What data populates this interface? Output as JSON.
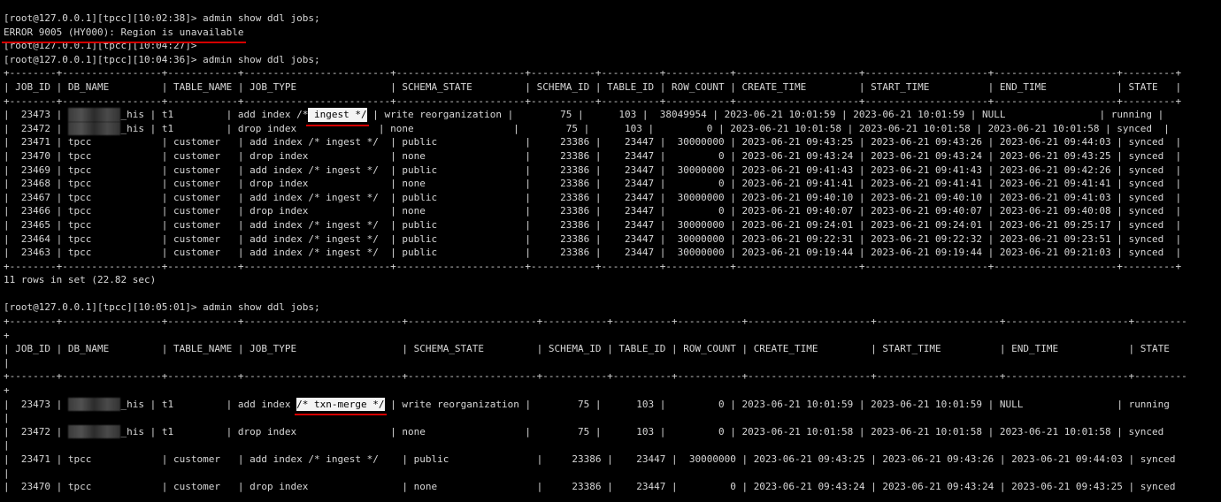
{
  "terminal": {
    "lines_top": [
      {
        "parts": [
          {
            "t": "[root@127.0.0.1][tpcc][10:02:38]> admin show ddl jobs;"
          }
        ]
      },
      {
        "parts": [
          {
            "t": "ERROR 9005 (HY000): Region is unavailable",
            "cls": "ul"
          }
        ]
      },
      {
        "parts": [
          {
            "t": "[root@127.0.0.1][tpcc][10:04:27]>"
          }
        ]
      },
      {
        "parts": [
          {
            "t": "[root@127.0.0.1][tpcc][10:04:36]> admin show ddl jobs;"
          }
        ]
      },
      {
        "parts": [
          {
            "t": "+--------+-----------------+------------+-------------------------+----------------------+-----------+----------+-----------+---------------------+---------------------+---------------------+---------+"
          }
        ]
      },
      {
        "parts": [
          {
            "t": "| JOB_ID | DB_NAME         | TABLE_NAME | JOB_TYPE                | SCHEMA_STATE         | SCHEMA_ID | TABLE_ID | ROW_COUNT | CREATE_TIME         | START_TIME          | END_TIME            | STATE   |"
          }
        ]
      },
      {
        "parts": [
          {
            "t": "+--------+-----------------+------------+-------------------------+----------------------+-----------+----------+-----------+---------------------+---------------------+---------------------+---------+"
          }
        ]
      },
      {
        "parts": [
          {
            "t": "|  23473 | "
          },
          {
            "t": "xxxxxxxxx",
            "cls": "blur"
          },
          {
            "t": "_his | t1         | add index /*"
          },
          {
            "t": " ingest */",
            "cls": "hl"
          },
          {
            "t": " | write reorganization |        75 |      103 |  38049954 | 2023-06-21 10:01:59 | 2023-06-21 10:01:59 | NULL                | running |"
          }
        ]
      },
      {
        "parts": [
          {
            "t": "|  23472 | "
          },
          {
            "t": "xxxxxxxxx",
            "cls": "blur"
          },
          {
            "t": "_his | t1         | drop index              | none                 |        75 |      103 |         0 | 2023-06-21 10:01:58 | 2023-06-21 10:01:58 | 2023-06-21 10:01:58 | synced  |"
          }
        ]
      },
      {
        "parts": [
          {
            "t": "|  23471 | tpcc            | customer   | add index /* ingest */  | public               |     23386 |    23447 |  30000000 | 2023-06-21 09:43:25 | 2023-06-21 09:43:26 | 2023-06-21 09:44:03 | synced  |"
          }
        ]
      },
      {
        "parts": [
          {
            "t": "|  23470 | tpcc            | customer   | drop index              | none                 |     23386 |    23447 |         0 | 2023-06-21 09:43:24 | 2023-06-21 09:43:24 | 2023-06-21 09:43:25 | synced  |"
          }
        ]
      },
      {
        "parts": [
          {
            "t": "|  23469 | tpcc            | customer   | add index /* ingest */  | public               |     23386 |    23447 |  30000000 | 2023-06-21 09:41:43 | 2023-06-21 09:41:43 | 2023-06-21 09:42:26 | synced  |"
          }
        ]
      },
      {
        "parts": [
          {
            "t": "|  23468 | tpcc            | customer   | drop index              | none                 |     23386 |    23447 |         0 | 2023-06-21 09:41:41 | 2023-06-21 09:41:41 | 2023-06-21 09:41:41 | synced  |"
          }
        ]
      },
      {
        "parts": [
          {
            "t": "|  23467 | tpcc            | customer   | add index /* ingest */  | public               |     23386 |    23447 |  30000000 | 2023-06-21 09:40:10 | 2023-06-21 09:40:10 | 2023-06-21 09:41:03 | synced  |"
          }
        ]
      },
      {
        "parts": [
          {
            "t": "|  23466 | tpcc            | customer   | drop index              | none                 |     23386 |    23447 |         0 | 2023-06-21 09:40:07 | 2023-06-21 09:40:07 | 2023-06-21 09:40:08 | synced  |"
          }
        ]
      },
      {
        "parts": [
          {
            "t": "|  23465 | tpcc            | customer   | add index /* ingest */  | public               |     23386 |    23447 |  30000000 | 2023-06-21 09:24:01 | 2023-06-21 09:24:01 | 2023-06-21 09:25:17 | synced  |"
          }
        ]
      },
      {
        "parts": [
          {
            "t": "|  23464 | tpcc            | customer   | add index /* ingest */  | public               |     23386 |    23447 |  30000000 | 2023-06-21 09:22:31 | 2023-06-21 09:22:32 | 2023-06-21 09:23:51 | synced  |"
          }
        ]
      },
      {
        "parts": [
          {
            "t": "|  23463 | tpcc            | customer   | add index /* ingest */  | public               |     23386 |    23447 |  30000000 | 2023-06-21 09:19:44 | 2023-06-21 09:19:44 | 2023-06-21 09:21:03 | synced  |"
          }
        ]
      },
      {
        "parts": [
          {
            "t": "+--------+-----------------+------------+-------------------------+----------------------+-----------+----------+-----------+---------------------+---------------------+---------------------+---------+"
          }
        ]
      },
      {
        "parts": [
          {
            "t": "11 rows in set (22.82 sec)"
          }
        ]
      }
    ],
    "lines_bottom": [
      {
        "parts": [
          {
            "t": "[root@127.0.0.1][tpcc][10:05:01]> admin show ddl jobs;"
          }
        ]
      },
      {
        "parts": [
          {
            "t": "+--------+-----------------+------------+---------------------------+----------------------+-----------+----------+-----------+---------------------+---------------------+---------------------+---------"
          }
        ]
      },
      {
        "parts": [
          {
            "t": "+"
          }
        ]
      },
      {
        "parts": [
          {
            "t": "| JOB_ID | DB_NAME         | TABLE_NAME | JOB_TYPE                  | SCHEMA_STATE         | SCHEMA_ID | TABLE_ID | ROW_COUNT | CREATE_TIME         | START_TIME          | END_TIME            | STATE"
          }
        ]
      },
      {
        "parts": [
          {
            "t": "|"
          }
        ]
      },
      {
        "parts": [
          {
            "t": "+--------+-----------------+------------+---------------------------+----------------------+-----------+----------+-----------+---------------------+---------------------+---------------------+---------"
          }
        ]
      },
      {
        "parts": [
          {
            "t": "+"
          }
        ]
      },
      {
        "parts": [
          {
            "t": "|  23473 | "
          },
          {
            "t": "xxxxxxxxx",
            "cls": "blur"
          },
          {
            "t": "_his | t1         | add index "
          },
          {
            "t": "/* txn-merge */",
            "cls": "hl"
          },
          {
            "t": " | write reorganization |        75 |      103 |         0 | 2023-06-21 10:01:59 | 2023-06-21 10:01:59 | NULL                | running"
          }
        ]
      },
      {
        "parts": [
          {
            "t": "|"
          }
        ]
      },
      {
        "parts": [
          {
            "t": "|  23472 | "
          },
          {
            "t": "xxxxxxxxx",
            "cls": "blur"
          },
          {
            "t": "_his | t1         | drop index                | none                 |        75 |      103 |         0 | 2023-06-21 10:01:58 | 2023-06-21 10:01:58 | 2023-06-21 10:01:58 | synced"
          }
        ]
      },
      {
        "parts": [
          {
            "t": "|"
          }
        ]
      },
      {
        "parts": [
          {
            "t": "|  23471 | tpcc            | customer   | add index /* ingest */    | public               |     23386 |    23447 |  30000000 | 2023-06-21 09:43:25 | 2023-06-21 09:43:26 | 2023-06-21 09:44:03 | synced"
          }
        ]
      },
      {
        "parts": [
          {
            "t": "|"
          }
        ]
      },
      {
        "parts": [
          {
            "t": "|  23470 | tpcc            | customer   | drop index                | none                 |     23386 |    23447 |         0 | 2023-06-21 09:43:24 | 2023-06-21 09:43:24 | 2023-06-21 09:43:25 | synced"
          }
        ]
      }
    ]
  }
}
